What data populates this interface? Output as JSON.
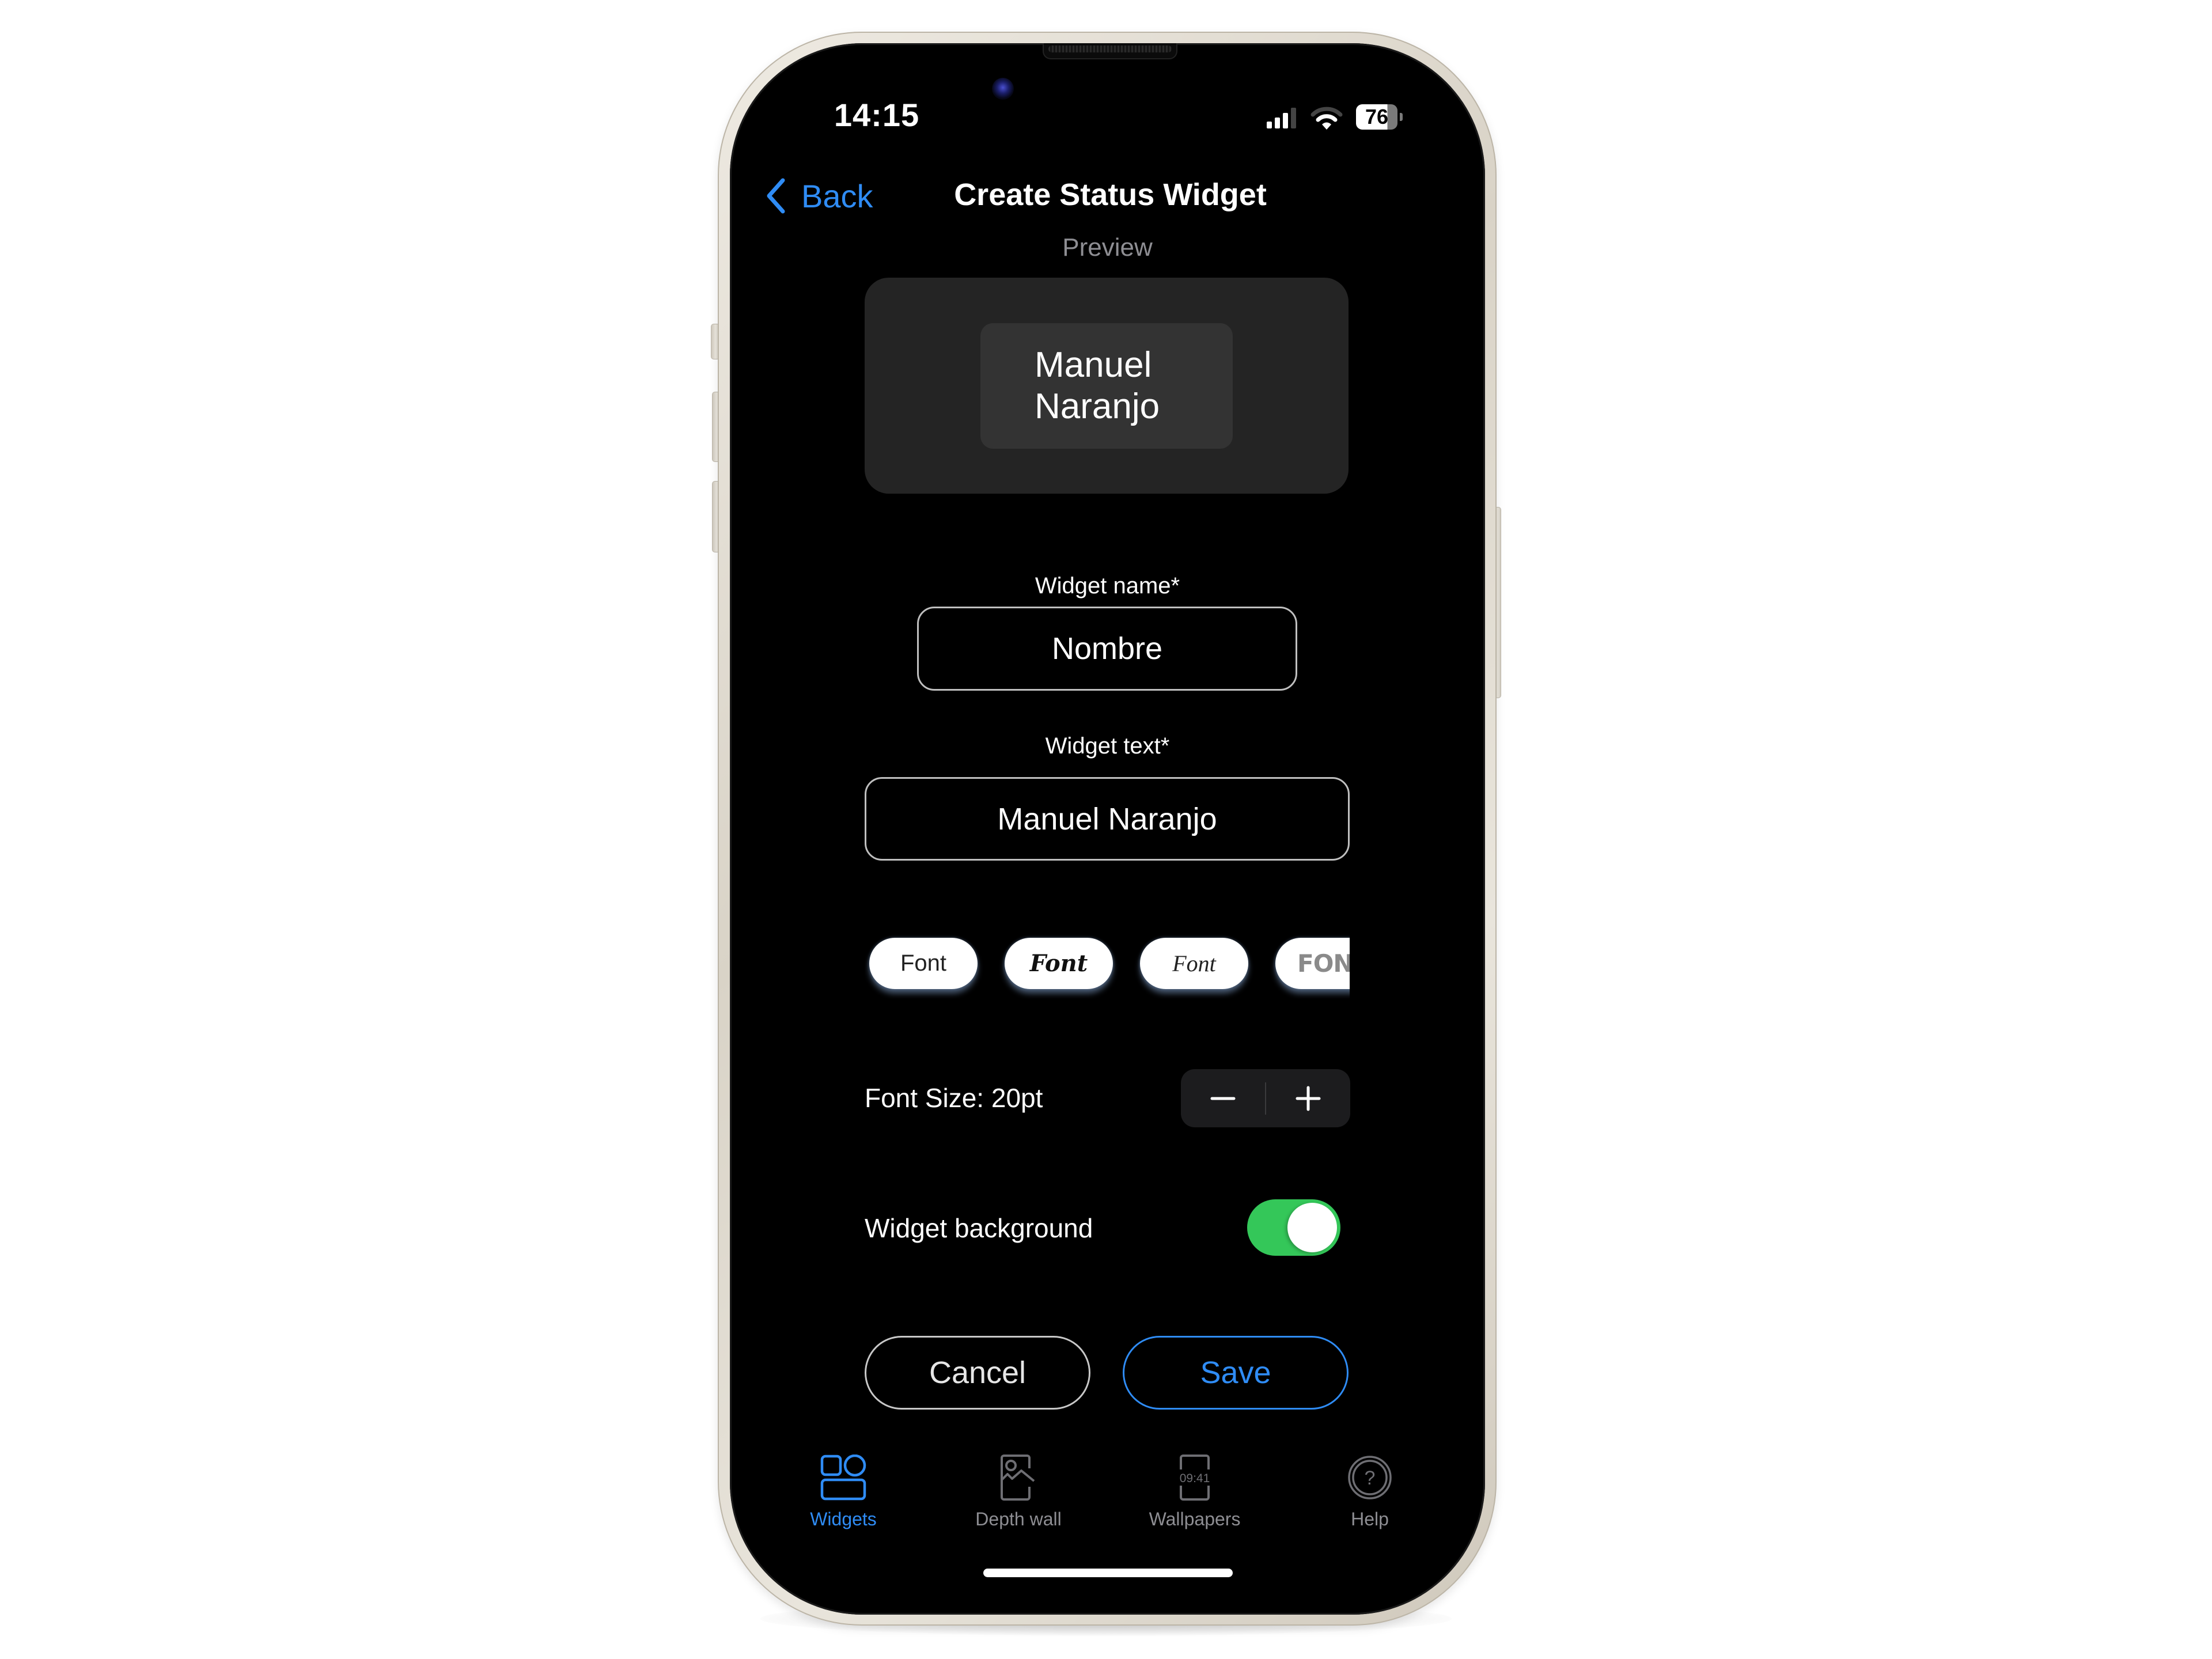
{
  "status_bar": {
    "time": "14:15",
    "battery_percent": "76",
    "signal_bars": 3,
    "signal_bars_total": 4,
    "wifi_level": 2,
    "wifi_level_total": 3
  },
  "nav": {
    "back_label": "Back",
    "title": "Create Status Widget"
  },
  "preview": {
    "label": "Preview",
    "text_line1": "Manuel",
    "text_line2": "Naranjo"
  },
  "form": {
    "widget_name_label": "Widget name*",
    "widget_name_value": "Nombre",
    "widget_text_label": "Widget text*",
    "widget_text_value": "Manuel Naranjo"
  },
  "fonts": {
    "options": [
      {
        "label": "Font",
        "style": "regular"
      },
      {
        "label": "Font",
        "style": "bold-italic-serif"
      },
      {
        "label": "Font",
        "style": "script"
      },
      {
        "label": "FONT",
        "style": "heavy-display"
      }
    ]
  },
  "font_size": {
    "label": "Font Size: 20pt",
    "value_pt": 20,
    "decrement_icon": "minus-icon",
    "increment_icon": "plus-icon"
  },
  "widget_background": {
    "label": "Widget background",
    "enabled": true
  },
  "actions": {
    "cancel_label": "Cancel",
    "save_label": "Save"
  },
  "tabbar": {
    "items": [
      {
        "label": "Widgets",
        "icon": "widgets-icon",
        "active": true
      },
      {
        "label": "Depth wall",
        "icon": "depth-wall-icon",
        "active": false
      },
      {
        "label": "Wallpapers",
        "icon": "wallpapers-icon",
        "icon_text": "09:41",
        "active": false
      },
      {
        "label": "Help",
        "icon": "help-icon",
        "icon_text": "?",
        "active": false
      }
    ]
  },
  "colors": {
    "accent_blue": "#2f8cf5",
    "toggle_green": "#34c759",
    "inactive_gray": "#8e8e93",
    "screen_bg": "#000000",
    "frame": "#e5e0d6"
  }
}
